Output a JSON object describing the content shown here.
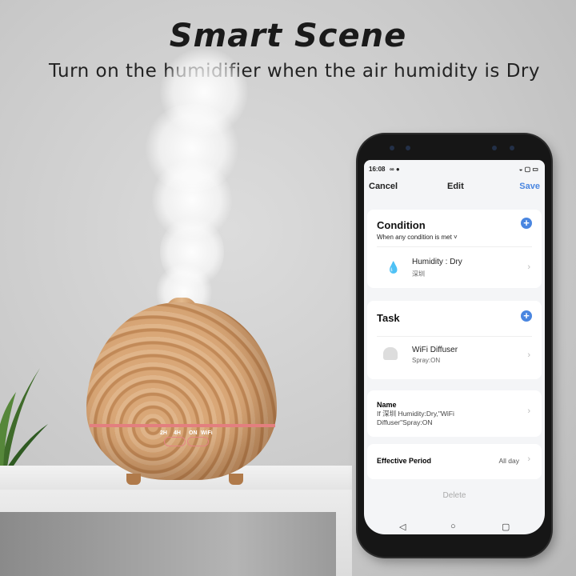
{
  "banner": {
    "title": "Smart Scene",
    "subtitle": "Turn on the humidifier when the air humidity is Dry"
  },
  "device": {
    "controls": [
      "2H",
      "4H",
      "ON",
      "WiFi"
    ],
    "light_color": "#e37f7f"
  },
  "phone": {
    "status_bar": {
      "time": "16:08",
      "icons": [
        "infinity-icon",
        "app-icon",
        "wifi-icon",
        "screen-icon",
        "battery-icon"
      ]
    },
    "nav": {
      "cancel": "Cancel",
      "title": "Edit",
      "save": "Save",
      "accent": "#4a86e0"
    },
    "condition": {
      "heading": "Condition",
      "mode": "When any condition is met",
      "item": {
        "title": "Humidity : Dry",
        "subtitle": "深圳",
        "icon": "water-drop-icon"
      }
    },
    "task": {
      "heading": "Task",
      "item": {
        "title": "WiFi Diffuser",
        "subtitle": "Spray:ON",
        "icon": "diffuser-icon"
      }
    },
    "name": {
      "label": "Name",
      "value": "If 深圳 Humidity:Dry,\"WiFi Diffuser\"Spray:ON"
    },
    "effective_period": {
      "label": "Effective Period",
      "value": "All day"
    },
    "delete": "Delete"
  }
}
